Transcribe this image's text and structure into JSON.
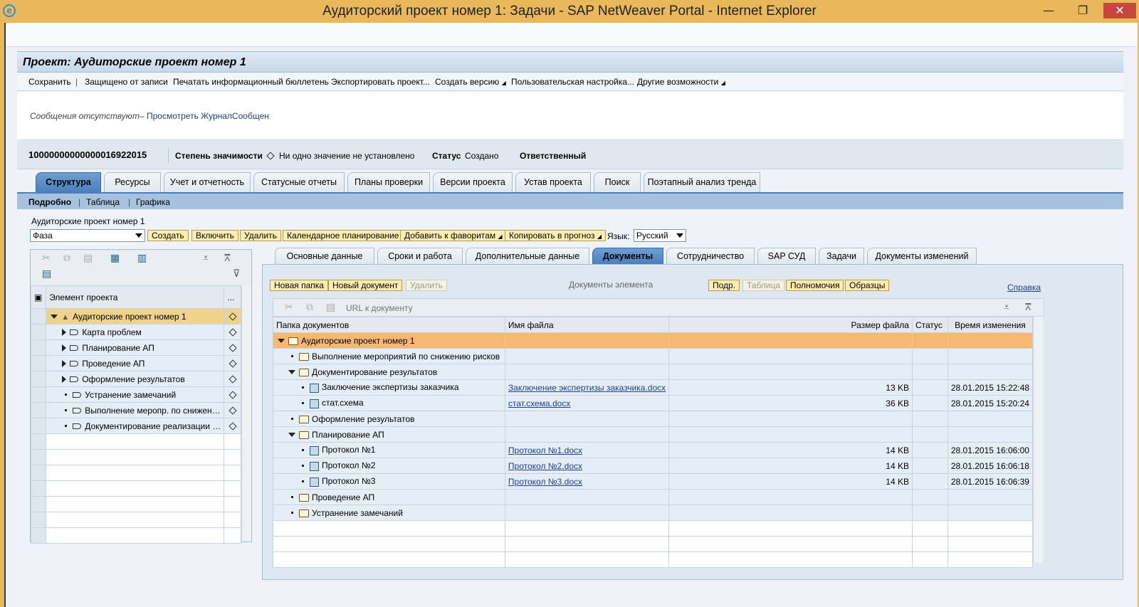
{
  "window": {
    "title": "Аудиторский проект номер 1: Задачи - SAP NetWeaver Portal - Internet Explorer",
    "min": "—",
    "max": "❐",
    "close": "✕"
  },
  "page": {
    "title": "Проект: Аудиторские проект номер 1"
  },
  "toolbar": {
    "save": "Сохранить",
    "protected": "Защищено от записи",
    "print": "Печатать информационный бюллетень",
    "export": "Экспортировать проект...",
    "create_version": "Создать версию",
    "user_settings": "Пользовательская настройка...",
    "other": "Другие возможности"
  },
  "messages": {
    "text": "Сообщения отсутствуют",
    "dash": "–",
    "link": "Просмотреть ЖурналСообщен"
  },
  "header": {
    "project_id": "10000000000000016922015",
    "significance_label": "Степень значимости",
    "significance_value": "Ни одно значение не установлено",
    "status_label": "Статус",
    "status_value": "Создано",
    "responsible_label": "Ответственный"
  },
  "tabs": [
    "Структура",
    "Ресурсы",
    "Учет и отчетность",
    "Статусные отчеты",
    "Планы проверки",
    "Версии проекта",
    "Устав проекта",
    "Поиск",
    "Поэтапный анализ тренда"
  ],
  "subtabs": [
    "Подробно",
    "Таблица",
    "Графика"
  ],
  "structure": {
    "project_name": "Аудиторские проект номер 1",
    "phase_select": "Фаза",
    "buttons": [
      "Создать",
      "Включить",
      "Удалить",
      "Календарное планирование",
      "Добавить к фаворитам",
      "Копировать в прогноз"
    ],
    "language_label": "Язык:",
    "language_value": "Русский"
  },
  "tree": {
    "column_header": "Элемент проекта",
    "column_header2": "...",
    "rows": [
      {
        "label": "Аудиторские проект номер 1",
        "level": 0,
        "toggle": "down"
      },
      {
        "label": "Карта проблем",
        "level": 1,
        "toggle": "right"
      },
      {
        "label": "Планирование АП",
        "level": 1,
        "toggle": "right"
      },
      {
        "label": "Проведение АП",
        "level": 1,
        "toggle": "right"
      },
      {
        "label": "Оформление результатов",
        "level": 1,
        "toggle": "right"
      },
      {
        "label": "Устранение замечаний",
        "level": 1,
        "toggle": "dot"
      },
      {
        "label": "Выполнение меропр. по снижен…",
        "level": 1,
        "toggle": "dot"
      },
      {
        "label": "Документирование реализации …",
        "level": 1,
        "toggle": "dot"
      }
    ]
  },
  "detail_tabs": [
    "Основные данные",
    "Сроки и работа",
    "Дополнительные данные",
    "Документы",
    "Сотрудничество",
    "SAP СУД",
    "Задачи",
    "Документы изменений"
  ],
  "documents": {
    "buttons_left": [
      "Новая папка",
      "Новый документ",
      "Удалить"
    ],
    "title": "Документы элемента",
    "buttons_right": [
      "Подр.",
      "Таблица",
      "Полномочия",
      "Образцы"
    ],
    "help": "Справка",
    "url_label": "URL к документу",
    "columns": [
      "Папка документов",
      "Имя файла",
      "Размер файла",
      "Статус",
      "Время изменения"
    ],
    "rows": [
      {
        "folder": "Аудиторские проект номер 1",
        "file": "",
        "size": "",
        "status": "",
        "time": "",
        "level": 0,
        "toggle": "down",
        "kind": "folder"
      },
      {
        "folder": "Выполнение мероприятий по снижению рисков",
        "file": "",
        "size": "",
        "status": "",
        "time": "",
        "level": 1,
        "toggle": "dot",
        "kind": "folder"
      },
      {
        "folder": "Документирование результатов",
        "file": "",
        "size": "",
        "status": "",
        "time": "",
        "level": 1,
        "toggle": "down",
        "kind": "folder"
      },
      {
        "folder": "Заключение экспертизы заказчика",
        "file": "Заключение экспертизы заказчика.docx",
        "size": "13 KB",
        "status": "",
        "time": "28.01.2015 15:22:48",
        "level": 2,
        "toggle": "dot",
        "kind": "doc"
      },
      {
        "folder": "стат.схема",
        "file": "стат.схема.docx",
        "size": "36 KB",
        "status": "",
        "time": "28.01.2015 15:20:24",
        "level": 2,
        "toggle": "dot",
        "kind": "doc"
      },
      {
        "folder": "Оформление результатов",
        "file": "",
        "size": "",
        "status": "",
        "time": "",
        "level": 1,
        "toggle": "dot",
        "kind": "folder"
      },
      {
        "folder": "Планирование АП",
        "file": "",
        "size": "",
        "status": "",
        "time": "",
        "level": 1,
        "toggle": "down",
        "kind": "folder"
      },
      {
        "folder": "Протокол №1",
        "file": "Протокол №1.docx",
        "size": "14 KB",
        "status": "",
        "time": "28.01.2015 16:06:00",
        "level": 2,
        "toggle": "dot",
        "kind": "doc"
      },
      {
        "folder": "Протокол №2",
        "file": "Протокол №2.docx",
        "size": "14 KB",
        "status": "",
        "time": "28.01.2015 16:06:18",
        "level": 2,
        "toggle": "dot",
        "kind": "doc"
      },
      {
        "folder": "Протокол №3",
        "file": "Протокол №3.docx",
        "size": "14 KB",
        "status": "",
        "time": "28.01.2015 16:06:39",
        "level": 2,
        "toggle": "dot",
        "kind": "doc"
      },
      {
        "folder": "Проведение АП",
        "file": "",
        "size": "",
        "status": "",
        "time": "",
        "level": 1,
        "toggle": "dot",
        "kind": "folder"
      },
      {
        "folder": "Устранение замечаний",
        "file": "",
        "size": "",
        "status": "",
        "time": "",
        "level": 1,
        "toggle": "dot",
        "kind": "folder"
      }
    ]
  },
  "colors": {
    "titlebar": "#e8b85a",
    "accent_tab": "#4a7fbf",
    "selected_row": "#f1d28a",
    "highlight_row": "#f8b871",
    "button": "#fdeeb0"
  }
}
